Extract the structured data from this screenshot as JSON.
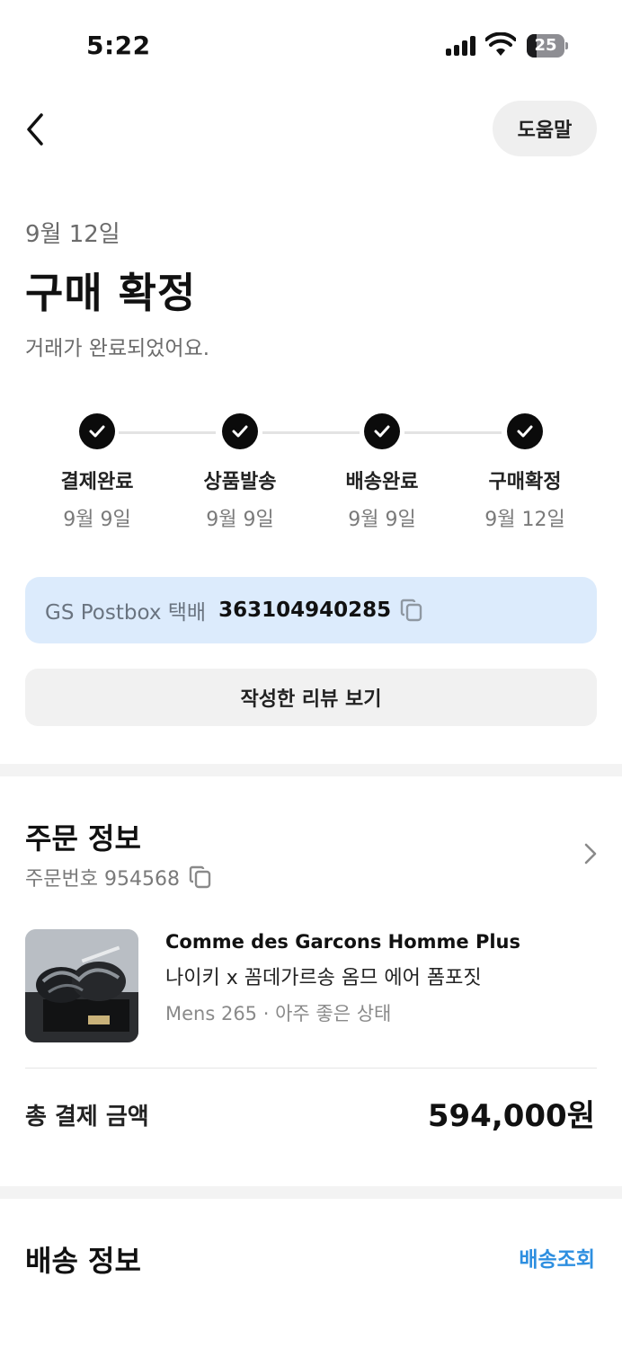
{
  "status_bar": {
    "time": "5:22",
    "battery": "25",
    "battery_level_percent": 25
  },
  "header": {
    "help_label": "도움말"
  },
  "summary": {
    "date": "9월 12일",
    "title": "구매 확정",
    "subtitle": "거래가 완료되었어요."
  },
  "steps": [
    {
      "label": "결제완료",
      "date": "9월 9일"
    },
    {
      "label": "상품발송",
      "date": "9월 9일"
    },
    {
      "label": "배송완료",
      "date": "9월 9일"
    },
    {
      "label": "구매확정",
      "date": "9월 12일"
    }
  ],
  "tracking": {
    "carrier": "GS Postbox 택배",
    "number": "363104940285"
  },
  "review_button": "작성한 리뷰 보기",
  "order": {
    "section_title": "주문 정보",
    "order_number": "주문번호 954568",
    "product": {
      "brand": "Comme des Garcons Homme Plus",
      "name": "나이키 x 꼼데가르송 옴므 에어 폼포짓",
      "option": "Mens 265 · 아주 좋은 상태"
    },
    "total_label": "총 결제 금액",
    "total_value": "594,000원"
  },
  "shipping": {
    "section_title": "배송 정보",
    "track_link": "배송조회"
  },
  "colors": {
    "accent": "#2e8fe0",
    "tracking_bg": "#dcebfc",
    "check": "#0b0b0b"
  }
}
